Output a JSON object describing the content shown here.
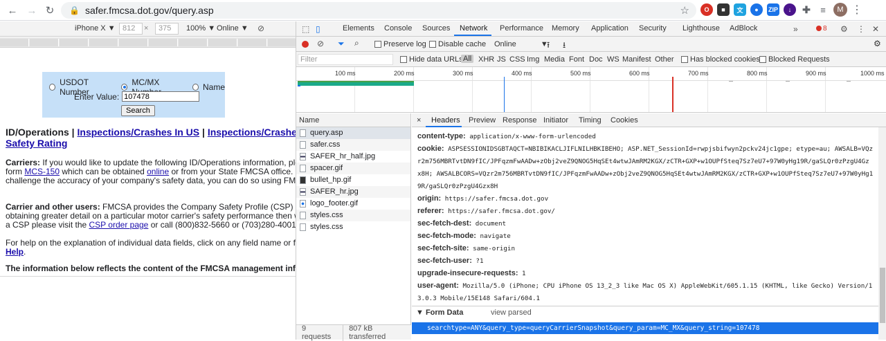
{
  "browser": {
    "url": "safer.fmcsa.dot.gov/query.asp",
    "avatar_letter": "M"
  },
  "device_toolbar": {
    "device": "iPhone X ▼",
    "width": "812",
    "x": "×",
    "height": "375",
    "zoom": "100% ▼",
    "network": "Online ▼"
  },
  "page": {
    "radio_usdot": "USDOT Number",
    "radio_mcmx": "MC/MX Number",
    "radio_name": "Name",
    "enter_value_label": "Enter Value:",
    "enter_value": "107478",
    "search_button": "Search",
    "title_prefix": "ID/Operations | ",
    "title_link1": "Inspections/Crashes In US",
    "title_sep": " | ",
    "title_link2": "Inspections/Crashes",
    "title_link3": "Safety Rating",
    "carriers_label": "Carriers:",
    "carriers_l1": " If you would like to update the following ID/Operations information, please c",
    "carriers_l2a": "form ",
    "carriers_link1": "MCS-150",
    "carriers_l2b": " which can be obtained ",
    "carriers_link2": "online",
    "carriers_l2c": " or from your State FMCSA office. If you",
    "carriers_l3": "challenge the accuracy of your company's safety data, you can do so using FMCSA's",
    "users_label": "Carrier and other users:",
    "users_l1": " FMCSA provides the Company Safety Profile (CSP) to mo",
    "users_l2": "obtaining greater detail on a particular motor carrier's safety performance then what i",
    "users_l3a": "a CSP please visit the ",
    "users_link": "CSP order page",
    "users_l3b": " or call (800)832-5660 or (703)280-4001 (Fee",
    "help_l1": "For help on the explanation of individual data fields, click on any field name or for hel",
    "help_link": "Help",
    "help_dot": ".",
    "info_line": "The information below reflects the content of the FMCSA management informat"
  },
  "devtools": {
    "tabs": [
      "Elements",
      "Console",
      "Sources",
      "Network",
      "Performance",
      "Memory",
      "Application",
      "Security",
      "Lighthouse",
      "AdBlock"
    ],
    "error_count": "8",
    "preserve_log": "Preserve log",
    "disable_cache": "Disable cache",
    "throttle": "Online",
    "filter_placeholder": "Filter",
    "hide_data_urls": "Hide data URLs",
    "filter_types": [
      "All",
      "XHR",
      "JS",
      "CSS",
      "Img",
      "Media",
      "Font",
      "Doc",
      "WS",
      "Manifest",
      "Other"
    ],
    "has_blocked_cookies": "Has blocked cookies",
    "blocked_requests": "Blocked Requests",
    "ticks": [
      "100 ms",
      "200 ms",
      "300 ms",
      "400 ms",
      "500 ms",
      "600 ms",
      "700 ms",
      "800 ms",
      "900 ms",
      "1000 ms"
    ],
    "name_header": "Name",
    "requests": [
      "query.asp",
      "safer.css",
      "SAFER_hr_half.jpg",
      "spacer.gif",
      "bullet_hp.gif",
      "SAFER_hr.jpg",
      "logo_footer.gif",
      "styles.css",
      "styles.css"
    ],
    "requests_count": "9 requests",
    "transferred": "807 kB transferred",
    "detail_tabs": [
      "×",
      "Headers",
      "Preview",
      "Response",
      "Initiator",
      "Timing",
      "Cookies"
    ],
    "headers": {
      "content_type_k": "content-type:",
      "content_type_v": "application/x-www-form-urlencoded",
      "cookie_k": "cookie:",
      "cookie_v1": "ASPSESSIONIDSGBTAQCT=NBIBIKACLJIFLNILHBKIBEHO; ASP.NET_SessionId=rwpjsbifwyn2pckv24jc1gpe; etype=au; AWSALB=VQz",
      "cookie_v2": "r2m756MBRTvtDN9fIC/JPFqzmFwAADw+zObj2veZ9QNOG5HqSEt4wtwJAmRM2KGX/zCTR+GXP+w1OUPfSteq7Sz7eU7+97W0yHg19R/gaSLQr0zPzgU4Gz",
      "cookie_v3": "x8H; AWSALBCORS=VQzr2m756MBRTvtDN9fIC/JPFqzmFwAADw+zObj2veZ9QNOG5HqSEt4wtwJAmRM2KGX/zCTR+GXP+w1OUPfSteq7Sz7eU7+97W0yHg1",
      "cookie_v4": "9R/gaSLQr0zPzgU4Gzx8H",
      "origin_k": "origin:",
      "origin_v": "https://safer.fmcsa.dot.gov",
      "referer_k": "referer:",
      "referer_v": "https://safer.fmcsa.dot.gov/",
      "dest_k": "sec-fetch-dest:",
      "dest_v": "document",
      "mode_k": "sec-fetch-mode:",
      "mode_v": "navigate",
      "site_k": "sec-fetch-site:",
      "site_v": "same-origin",
      "user_k": "sec-fetch-user:",
      "user_v": "?1",
      "upg_k": "upgrade-insecure-requests:",
      "upg_v": "1",
      "ua_k": "user-agent:",
      "ua_v1": "Mozilla/5.0 (iPhone; CPU iPhone OS 13_2_3 like Mac OS X) AppleWebKit/605.1.15 (KHTML, like Gecko) Version/1",
      "ua_v2": "3.0.3 Mobile/15E148 Safari/604.1"
    },
    "form_data_label": "▼ Form Data",
    "view_parsed": "view parsed",
    "form_data_value": "searchtype=ANY&query_type=queryCarrierSnapshot&query_param=MC_MX&query_string=107478"
  }
}
